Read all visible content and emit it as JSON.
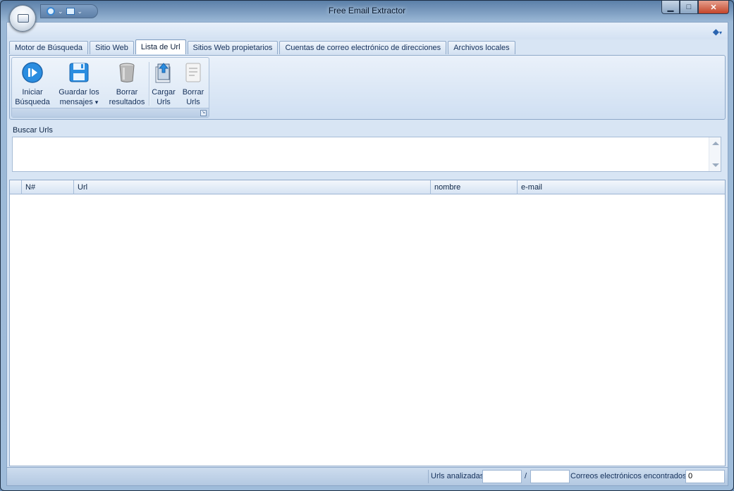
{
  "window": {
    "title": "Free Email Extractor",
    "controls": {
      "minimize": "▁",
      "maximize": "□",
      "close": "✕"
    }
  },
  "ribbon": {
    "tabs": [
      {
        "label": "Motor de Búsqueda"
      },
      {
        "label": "Sitio Web"
      },
      {
        "label": "Lista de Url",
        "active": true
      },
      {
        "label": "Sitios Web propietarios"
      },
      {
        "label": "Cuentas de correo electrónico de direcciones"
      },
      {
        "label": "Archivos locales"
      }
    ],
    "buttons": {
      "start": {
        "line1": "Iniciar",
        "line2": "Búsqueda",
        "icon": "play-icon"
      },
      "save": {
        "line1": "Guardar los",
        "line2": "mensajes",
        "dropdown": "▾",
        "icon": "floppy-disk-icon"
      },
      "clear": {
        "line1": "Borrar",
        "line2": "resultados",
        "icon": "trash-can-icon"
      },
      "load": {
        "line1": "Cargar",
        "line2": "Urls",
        "icon": "load-document-icon"
      },
      "delete": {
        "line1": "Borrar",
        "line2": "Urls",
        "icon": "blank-document-icon"
      }
    },
    "accent": "#2a8de0"
  },
  "search": {
    "label": "Buscar Urls",
    "value": ""
  },
  "grid": {
    "columns": [
      "N#",
      "Url",
      "nombre",
      "e-mail"
    ],
    "rows": []
  },
  "status": {
    "urls_label": "Urls analizadas",
    "urls_done": "",
    "separator": "/",
    "urls_total": "",
    "emails_label": "Correos electrónicos encontrados",
    "emails_count": "0"
  }
}
